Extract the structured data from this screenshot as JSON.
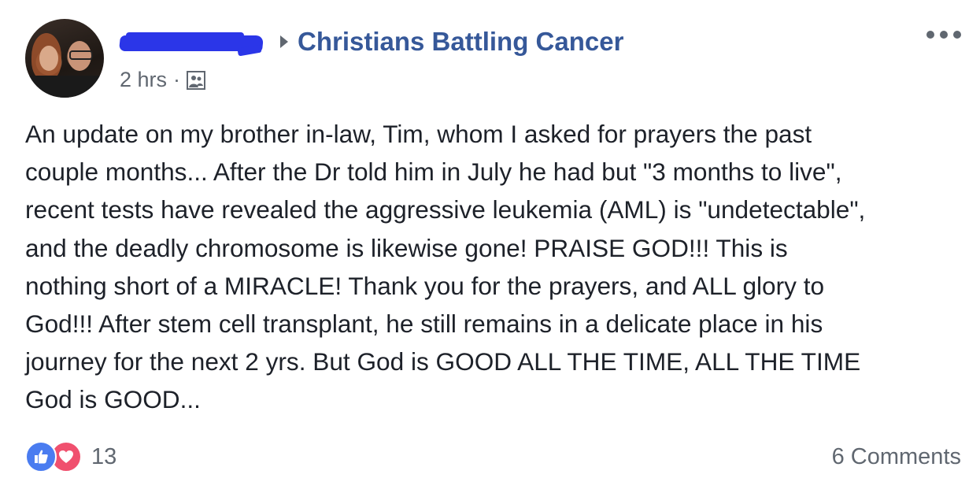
{
  "post": {
    "group_name": "Christians Battling Cancer",
    "timestamp": "2 hrs",
    "separator": "·",
    "privacy_icon": "group-icon",
    "author_name_redacted": true,
    "body": "An update on my brother in-law, Tim, whom I asked for prayers the past\ncouple months... After the Dr told him in July he had but \"3 months to live\",\nrecent tests have revealed the aggressive leukemia (AML) is \"undetectable\",\nand the deadly chromosome is likewise gone! PRAISE GOD!!! This is\nnothing short of a MIRACLE! Thank you for the prayers, and ALL glory to\nGod!!! After stem cell transplant, he still remains in a delicate place in his\njourney for the next 2 yrs. But God is GOOD ALL THE TIME, ALL THE TIME\nGod is GOOD..."
  },
  "footer": {
    "reaction_count": "13",
    "reaction_icons": [
      "like-icon",
      "love-icon"
    ],
    "comments_label": "6 Comments"
  },
  "colors": {
    "link": "#365899",
    "text": "#1d2129",
    "muted": "#606770",
    "like": "#4a7cf0",
    "love": "#f0506e",
    "redaction": "#2b36e8"
  }
}
